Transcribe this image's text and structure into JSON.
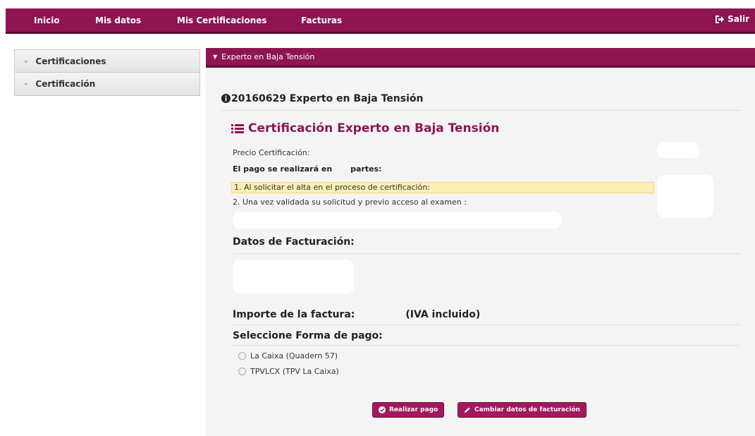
{
  "nav": {
    "items": [
      "Inicio",
      "Mis datos",
      "Mis Certificaciones",
      "Facturas"
    ],
    "logout": "Salir",
    "logout_icon": "sign-out-icon",
    "bar_color": "#8e1552"
  },
  "sidebar": {
    "items": [
      {
        "label": "Certificaciones",
        "icon": "chevron-right-icon"
      },
      {
        "label": "Certificación",
        "icon": "chevron-right-icon"
      }
    ]
  },
  "panel": {
    "header": "Experto en Baja Tensión",
    "header_icon": "caret-down-icon",
    "cert_code_title": "20160629 Experto en Baja Tensión",
    "cert_code_icon": "info-circle-icon",
    "subtitle": "Certificación Experto en Baja Tensión",
    "subtitle_icon": "list-icon",
    "price_label": "Precio Certificación:",
    "pago_prefix": "El pago se realizará en",
    "pago_suffix": "partes:",
    "step1": "1. Al solicitar el alta en el proceso de certificación:",
    "step2": "2. Una vez validada su solicitud y previo acceso al examen :",
    "datos_title": "Datos de Facturación:",
    "importe_label": "Importe de la factura:",
    "importe_iva": "(IVA incluido)",
    "forma_title": "Seleccione Forma de pago:",
    "payment_options": [
      "La Caixa (Quadern 57)",
      "TPVLCX (TPV La Caixa)"
    ],
    "buttons": {
      "pay": "Realizar pago",
      "pay_icon": "check-circle-icon",
      "change": "Cambiar datos de facturación",
      "change_icon": "pencil-icon"
    },
    "highlight_color": "#fbf0b4"
  }
}
